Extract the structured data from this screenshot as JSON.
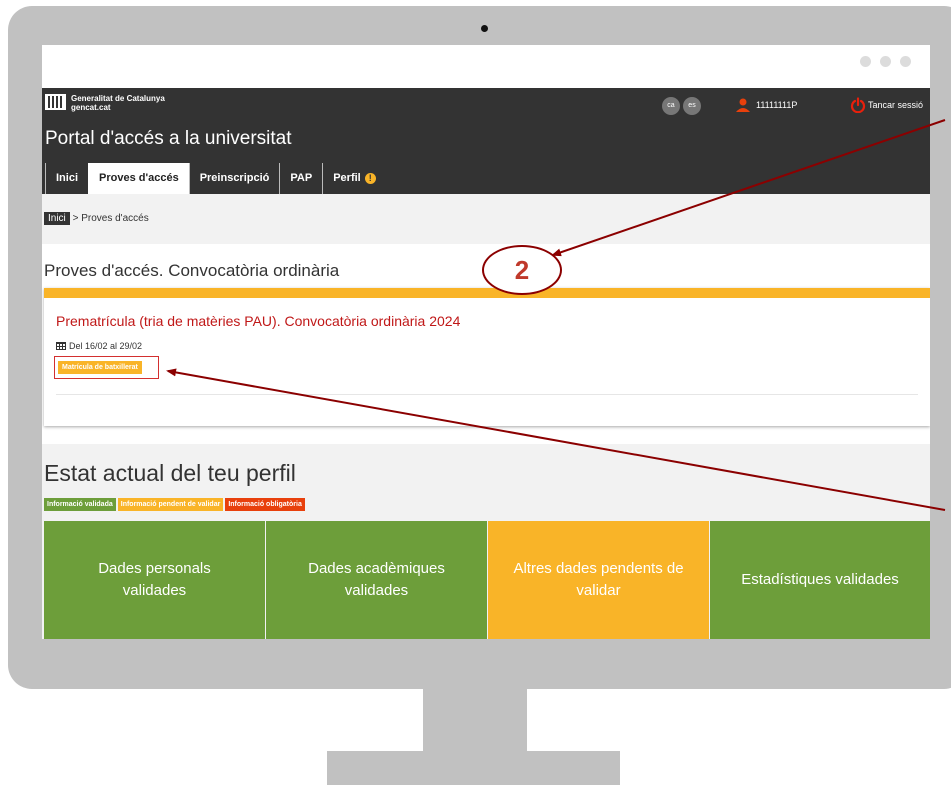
{
  "header": {
    "brand_line1": "Generalitat de Catalunya",
    "brand_line2": "gencat.cat",
    "languages": [
      "ca",
      "es"
    ],
    "user_id": "11111111P",
    "logout_label": "Tancar sessió",
    "portal_title": "Portal d'accés a la universitat"
  },
  "nav": {
    "tabs": [
      {
        "label": "Inici"
      },
      {
        "label": "Proves d'accés",
        "active": true
      },
      {
        "label": "Preinscripció"
      },
      {
        "label": "PAP"
      },
      {
        "label": "Perfil",
        "warning": "!"
      }
    ]
  },
  "breadcrumb": {
    "home": "Inici",
    "current": "> Proves d'accés"
  },
  "exams": {
    "section_title": "Proves d'accés. Convocatòria ordinària",
    "card_title": "Prematrícula (tria de matèries PAU). Convocatòria ordinària 2024",
    "dates": "Del 16/02 al 29/02",
    "badge": "Matrícula de batxillerat"
  },
  "profile": {
    "title": "Estat actual del teu perfil",
    "legend": [
      "Informació validada",
      "Informació pendent de validar",
      "Informació obligatòria"
    ],
    "tiles": [
      {
        "line1": "Dades personals",
        "line2": "validades",
        "status": "validated"
      },
      {
        "line1": "Dades acadèmiques",
        "line2": "validades",
        "status": "validated"
      },
      {
        "line1": "Altres dades pendents de",
        "line2": "validar",
        "status": "pending"
      },
      {
        "line1": "Estadístiques validades",
        "line2": "",
        "status": "validated"
      }
    ]
  },
  "annotation": {
    "step_number": "2"
  },
  "colors": {
    "header_bg": "#333333",
    "accent_yellow": "#f9b428",
    "validated_green": "#6d9e3a",
    "required_red": "#e8400c",
    "link_red": "#c01818",
    "annotation_red": "#8b0000"
  }
}
